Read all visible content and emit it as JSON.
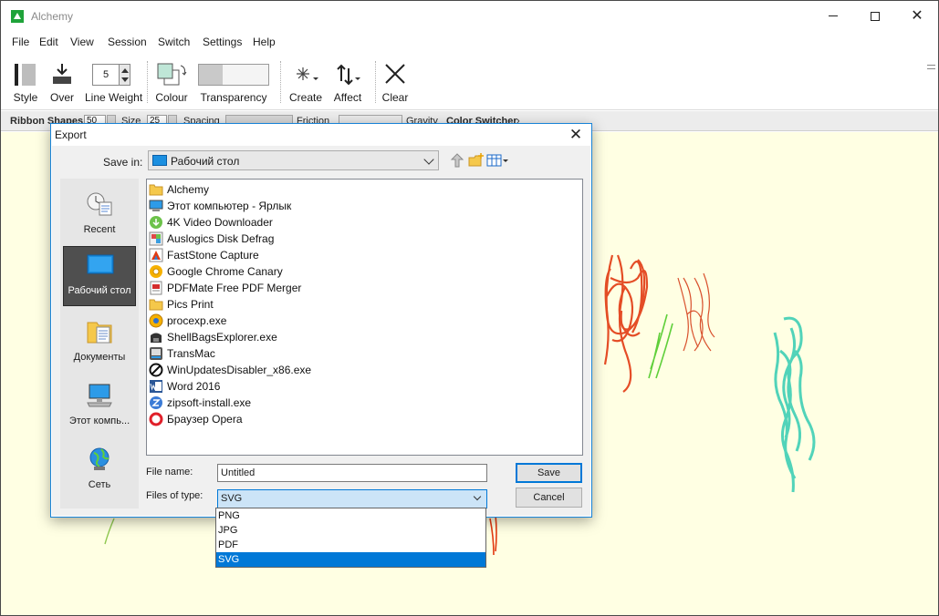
{
  "window": {
    "title": "Alchemy"
  },
  "menu": [
    "File",
    "Edit",
    "View",
    "Session",
    "Switch",
    "Settings",
    "Help"
  ],
  "toolbar": {
    "style": "Style",
    "over": "Over",
    "line_weight": "Line Weight",
    "line_weight_value": "5",
    "colour": "Colour",
    "transparency": "Transparency",
    "create": "Create",
    "affect": "Affect",
    "clear": "Clear"
  },
  "ribbon_bar": {
    "module": "Ribbon Shapes",
    "first_value": "50",
    "size_label": "Size",
    "size_value": "25",
    "spacing_label": "Spacing",
    "friction_label": "Friction",
    "gravity_label": "Gravity",
    "color_switcher": "Color Switcher"
  },
  "canvas": {
    "background": "#ffffe3"
  },
  "dialog": {
    "title": "Export",
    "save_in_label": "Save in:",
    "save_in_value": "Рабочий стол",
    "places": [
      {
        "label": "Recent",
        "icon": "recent-icon",
        "selected": false
      },
      {
        "label": "Рабочий стол",
        "icon": "desktop-icon",
        "selected": true
      },
      {
        "label": "Документы",
        "icon": "documents-icon",
        "selected": false
      },
      {
        "label": "Этот компь...",
        "icon": "computer-icon",
        "selected": false
      },
      {
        "label": "Сеть",
        "icon": "network-icon",
        "selected": false
      }
    ],
    "files": [
      {
        "name": "Alchemy",
        "icon": "folder-icon"
      },
      {
        "name": "Этот компьютер - Ярлык",
        "icon": "computer-shortcut-icon"
      },
      {
        "name": "4K Video Downloader",
        "icon": "video-downloader-icon"
      },
      {
        "name": "Auslogics Disk Defrag",
        "icon": "defrag-icon"
      },
      {
        "name": "FastStone Capture",
        "icon": "faststone-icon"
      },
      {
        "name": "Google Chrome Canary",
        "icon": "chrome-canary-icon"
      },
      {
        "name": "PDFMate Free PDF Merger",
        "icon": "pdf-merger-icon"
      },
      {
        "name": "Pics Print",
        "icon": "pics-print-icon"
      },
      {
        "name": "procexp.exe",
        "icon": "procexp-icon"
      },
      {
        "name": "ShellBagsExplorer.exe",
        "icon": "shellbags-icon"
      },
      {
        "name": "TransMac",
        "icon": "transmac-icon"
      },
      {
        "name": "WinUpdatesDisabler_x86.exe",
        "icon": "winupdates-disabler-icon"
      },
      {
        "name": "Word 2016",
        "icon": "word-icon"
      },
      {
        "name": "zipsoft-install.exe",
        "icon": "zipsoft-icon"
      },
      {
        "name": "Браузер Opera",
        "icon": "opera-icon"
      }
    ],
    "file_name_label": "File name:",
    "file_name_value": "Untitled",
    "file_type_label": "Files of type:",
    "file_type_value": "SVG",
    "file_type_options": [
      "PNG",
      "JPG",
      "PDF",
      "SVG"
    ],
    "save_button": "Save",
    "cancel_button": "Cancel"
  },
  "colors": {
    "accent": "#0078d7",
    "canvas_bg": "#ffffe3",
    "stroke_red": "#e23a12",
    "stroke_teal": "#3fcfb5",
    "stroke_green": "#5fcf3a"
  }
}
